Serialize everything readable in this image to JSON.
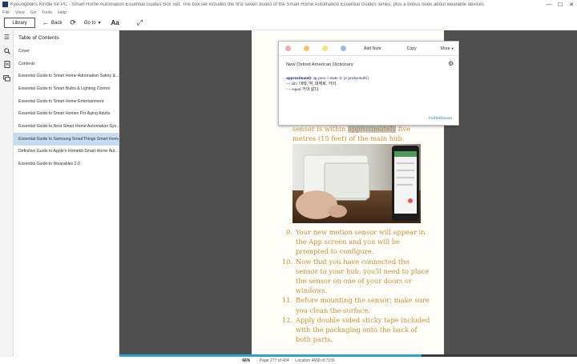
{
  "titlebar": {
    "text": "Kyoungbok's Kindle for PC - Smart Home Automation Essential Guides Box Set: The box set includes the first seven books of the Smart Home Automation Essential Guides series, plus a bonus book about wearable devices",
    "minimize": "—",
    "maximize": "☐",
    "close": "✕"
  },
  "menu": [
    "File",
    "View",
    "Go",
    "Tools",
    "Help"
  ],
  "toolbar": {
    "library": "Library",
    "back": "Back",
    "goto": "Go to",
    "font": "Aa"
  },
  "toc": {
    "title": "Table of Contents",
    "items": [
      "Cover",
      "Contents",
      "Essential Guide to Smart Home Automation Safety &...",
      "Essential Guide to Smart Bulbs & Lighting Control",
      "Essential Guide to Smart Home Entertainment",
      "Essential Guide to Smart Homes For Aging Adults",
      "Essential Guide to Nest Smart Home Automation Sys...",
      "Essential Guide to Samsung SmartThings Smart Home...",
      "Definitive Guide to Apple's Homekit Smart Home Aut...",
      "Essential Guide to Wearables 2.0"
    ],
    "active_index": 7
  },
  "dictionary": {
    "actions": [
      "Add Note",
      "Copy",
      "More"
    ],
    "highlight_colors": [
      "#f4a7b9",
      "#f5c36b",
      "#f3e27a",
      "#9db8e8"
    ],
    "source": "New Oxford American Dictionary",
    "headword": "approximately",
    "pronunciation": "ap·prox·i·mate·ly [əˈprɑksɪmətli]",
    "line1_pos": "adv.",
    "line1_text": "대략, 약, 대체로, 거의.",
    "line2_prefix": "- ~",
    "line2_word": "equal",
    "line2_text": "거의 같다.",
    "full_definition": "Full Definition"
  },
  "book": {
    "continued_before": "sensor is within",
    "highlight_word": "approximately",
    "continued_after": "five",
    "continued_line2": "metres (15 feet) of the main hub.",
    "steps": [
      {
        "num": "9.",
        "lines": [
          "Your new motion sensor will appear in",
          "the App screen and you will be",
          "prompted to configure."
        ]
      },
      {
        "num": "10.",
        "lines": [
          "Now that you have connected the",
          "sensor to your hub, you'll need to place",
          "the sensor on one of your doors or",
          "windows."
        ]
      },
      {
        "num": "11.",
        "lines": [
          "Before mounting the sensor; make sure",
          "you clean the surface."
        ]
      },
      {
        "num": "12.",
        "lines": [
          "Apply double sided sticky tape included",
          "with the packaging onto the back of",
          "both parts."
        ]
      }
    ]
  },
  "status": {
    "percent": "66%",
    "page": "Page 277 of 434",
    "location": "Location 4660 of 7155",
    "progress": 0.66
  }
}
